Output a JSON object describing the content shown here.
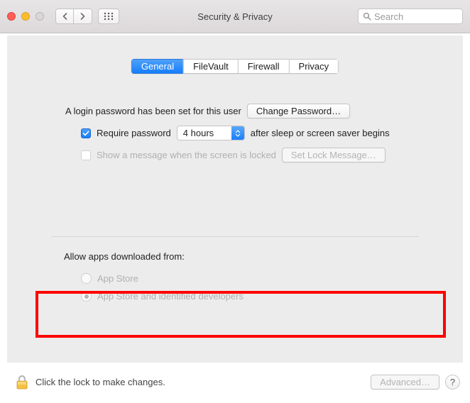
{
  "window": {
    "title": "Security & Privacy"
  },
  "search": {
    "placeholder": "Search"
  },
  "tabs": [
    {
      "label": "General",
      "active": true
    },
    {
      "label": "FileVault",
      "active": false
    },
    {
      "label": "Firewall",
      "active": false
    },
    {
      "label": "Privacy",
      "active": false
    }
  ],
  "loginPassword": {
    "message": "A login password has been set for this user",
    "button": "Change Password…"
  },
  "requirePassword": {
    "checked": true,
    "pre": "Require password",
    "delay": "4 hours",
    "post": "after sleep or screen saver begins"
  },
  "lockMessage": {
    "checked": false,
    "label": "Show a message when the screen is locked",
    "button": "Set Lock Message…"
  },
  "allowApps": {
    "heading": "Allow apps downloaded from:",
    "options": [
      {
        "label": "App Store",
        "selected": false
      },
      {
        "label": "App Store and identified developers",
        "selected": true
      }
    ]
  },
  "footer": {
    "lockText": "Click the lock to make changes.",
    "advanced": "Advanced…",
    "help": "?"
  }
}
